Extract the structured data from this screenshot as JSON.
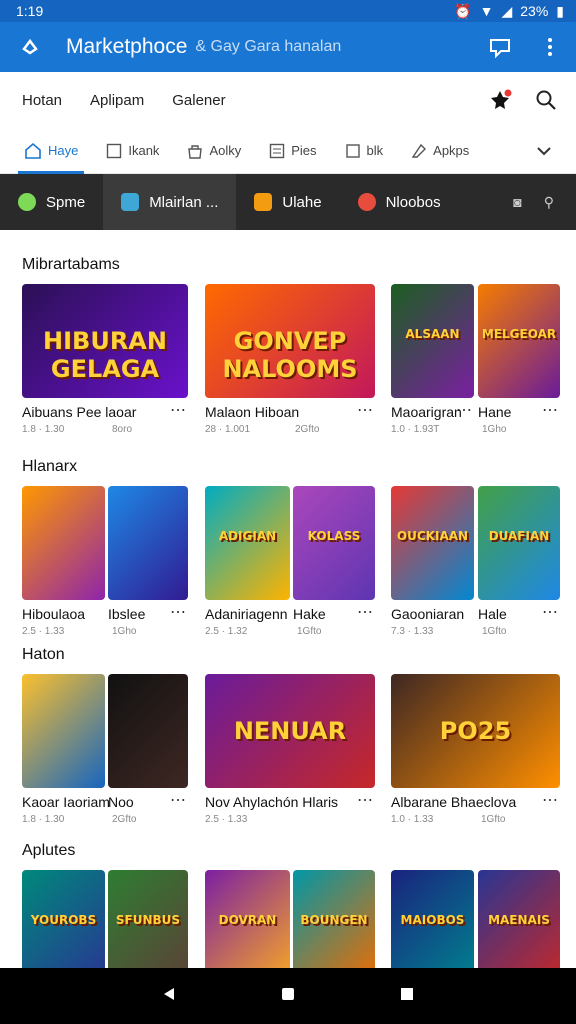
{
  "status": {
    "time": "1:19",
    "battery": "23%"
  },
  "app_bar": {
    "title": "Marketphoce",
    "subtitle": "& Gay Gara hanalan"
  },
  "top_nav": {
    "links": [
      "Hotan",
      "Aplipam",
      "Galener"
    ]
  },
  "tabs": [
    {
      "label": "Haye",
      "icon": "home-icon",
      "active": true
    },
    {
      "label": "Ikank",
      "icon": "rank-icon",
      "active": false
    },
    {
      "label": "Aolky",
      "icon": "bag-icon",
      "active": false
    },
    {
      "label": "Pies",
      "icon": "list-icon",
      "active": false
    },
    {
      "label": "blk",
      "icon": "book-icon",
      "active": false
    },
    {
      "label": "Apkps",
      "icon": "tag-icon",
      "active": false
    }
  ],
  "categories": [
    {
      "label": "Spme",
      "color": "#7ed957"
    },
    {
      "label": "Mlairlan ...",
      "color": "#3fa7d6"
    },
    {
      "label": "Ulahe",
      "color": "#f39c12"
    },
    {
      "label": "Nloobos",
      "color": "#e74c3c"
    }
  ],
  "sections": [
    {
      "title": "Mibrartabams",
      "cards": [
        {
          "title": "Aibuans Pee laoar",
          "meta": "1.8 · 1.30",
          "meta2": "8oro",
          "art": "HIBURAN GELAGA",
          "colors": [
            "#2b1055",
            "#6a11cb"
          ]
        },
        {
          "title": "Malaon Hiboan",
          "meta": "28 · 1.001",
          "meta2": "2Gfto",
          "art": "GONVEP NALOOMS",
          "colors": [
            "#ff6a00",
            "#c2185b"
          ]
        },
        {
          "title": "Maoarigran",
          "meta": "1.0 · 1.93T",
          "meta2": "",
          "art": "ALSAAN",
          "colors": [
            "#1b5e20",
            "#7b1fa2"
          ]
        },
        {
          "title": "Hane",
          "meta": "",
          "meta2": "1Gho",
          "art": "MELGEOAR",
          "colors": [
            "#f57c00",
            "#6a1b9a"
          ]
        }
      ]
    },
    {
      "title": "Hlanarx",
      "cards": [
        {
          "title": "Hiboulaoa",
          "meta": "2.5 · 1.33",
          "meta2": "",
          "art": "",
          "colors": [
            "#ff9800",
            "#8e24aa"
          ]
        },
        {
          "title": "Ibslee",
          "meta": "",
          "meta2": "1Gho",
          "art": "",
          "colors": [
            "#1e88e5",
            "#311b92"
          ]
        },
        {
          "title": "Adaniriagenn",
          "meta": "2.5 · 1.32",
          "meta2": "",
          "art": "ADIGIAN",
          "colors": [
            "#00acc1",
            "#ffb300"
          ]
        },
        {
          "title": "Hake",
          "meta": "",
          "meta2": "1Gfto",
          "art": "KOLASS",
          "colors": [
            "#ab47bc",
            "#5e35b1"
          ]
        },
        {
          "title": "Gaooniaran",
          "meta": "7.3 · 1.33",
          "meta2": "",
          "art": "OUCKIAAN",
          "colors": [
            "#e53935",
            "#0288d1"
          ]
        },
        {
          "title": "Hale",
          "meta": "",
          "meta2": "1Gfto",
          "art": "DUAFIAN",
          "colors": [
            "#43a047",
            "#1e88e5"
          ]
        }
      ]
    },
    {
      "title": "Haton",
      "cards": [
        {
          "title": "Kaoar Iaoriam",
          "meta": "1.8 · 1.30",
          "meta2": "",
          "art": "",
          "colors": [
            "#fbc02d",
            "#1565c0"
          ]
        },
        {
          "title": "Noo",
          "meta": "",
          "meta2": "2Gfto",
          "art": "",
          "colors": [
            "#111111",
            "#3e2723"
          ]
        },
        {
          "title": "Nov Ahylachón Hlaris",
          "meta": "2.5 · 1.33",
          "meta2": "",
          "art": "NENUAR",
          "colors": [
            "#6a1b9a",
            "#c62828"
          ]
        },
        {
          "title": "Albarane Bhaeclova",
          "meta": "1.0 · 1.33",
          "meta2": "1Gfto",
          "art": "PO25",
          "colors": [
            "#3e2723",
            "#ff8f00"
          ]
        }
      ]
    },
    {
      "title": "Aplutes",
      "cards": [
        {
          "title": "",
          "meta": "",
          "meta2": "",
          "art": "YOUROBS",
          "colors": [
            "#00897b",
            "#283593"
          ]
        },
        {
          "title": "",
          "meta": "",
          "meta2": "",
          "art": "SFUNBUS",
          "colors": [
            "#2e7d32",
            "#5d4037"
          ]
        },
        {
          "title": "",
          "meta": "",
          "meta2": "",
          "art": "DOVRAN",
          "colors": [
            "#7b1fa2",
            "#f9a825"
          ]
        },
        {
          "title": "",
          "meta": "",
          "meta2": "",
          "art": "BOUNGEN",
          "colors": [
            "#0097a7",
            "#ef6c00"
          ]
        },
        {
          "title": "",
          "meta": "",
          "meta2": "",
          "art": "MAIOBOS",
          "colors": [
            "#1a237e",
            "#00838f"
          ]
        },
        {
          "title": "",
          "meta": "",
          "meta2": "",
          "art": "MAENAIS",
          "colors": [
            "#283593",
            "#c62828"
          ]
        }
      ]
    }
  ],
  "colors": {
    "primary": "#1976d2",
    "status": "#1565c0",
    "dark_bar": "#2a2a2a"
  }
}
